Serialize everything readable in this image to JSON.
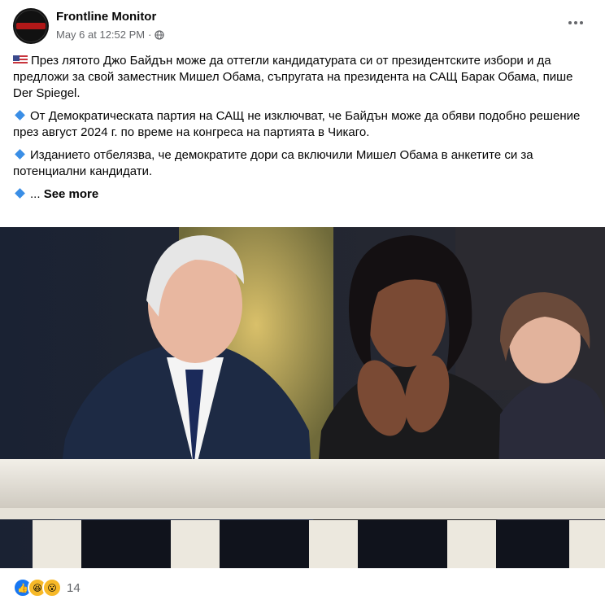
{
  "post": {
    "page_name": "Frontline Monitor",
    "timestamp": "May 6 at 12:52 PM",
    "separator": "·",
    "privacy_icon": "globe-icon",
    "more_icon": "more-horizontal-icon"
  },
  "content": {
    "para1": "През лятото Джо Байдън може да оттегли кандидатурата си от президентските избори и да предложи за свой заместник Мишел Обама, съпругата на президента на САЩ Барак Обама, пише Der Spiegel.",
    "para2": "От Демократическата партия на САЩ не изключват, че Байдън може да обяви подобно решение през август 2024 г. по време на конгреса на партията в Чикаго.",
    "para3": "Изданието отбелязва, че демократите дори са включили Мишел Обама в анкетите си за потенциални кандидати.",
    "para4_prefix": "...",
    "see_more": "See more"
  },
  "footer": {
    "reaction_icons": [
      "like-icon",
      "haha-icon",
      "wow-icon"
    ],
    "reaction_count": "14"
  },
  "colors": {
    "text": "#050505",
    "meta": "#65676b",
    "like_blue": "#1877f2",
    "emoji_yellow": "#f7b928"
  }
}
